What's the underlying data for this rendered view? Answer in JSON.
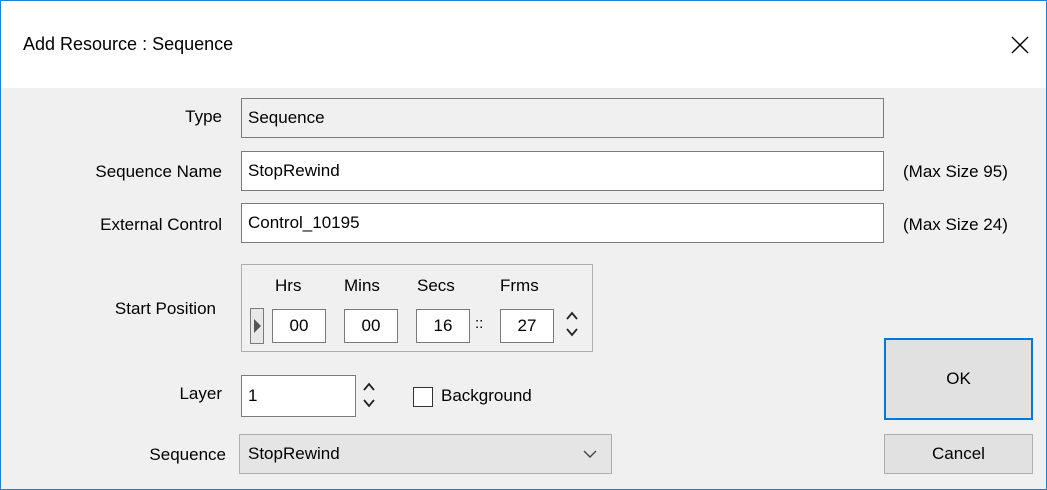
{
  "window": {
    "title": "Add Resource : Sequence",
    "close_label": "close"
  },
  "form": {
    "type_label": "Type",
    "type_value": "Sequence",
    "name_label": "Sequence Name",
    "name_value": "StopRewind",
    "name_hint": "(Max Size 95)",
    "external_label": "External Control",
    "external_value": "Control_10195",
    "external_hint": "(Max Size 24)",
    "start_label": "Start Position",
    "timecode": {
      "hrs_label": "Hrs",
      "mins_label": "Mins",
      "secs_label": "Secs",
      "frms_label": "Frms",
      "hrs": "00",
      "mins": "00",
      "secs": "16",
      "frms": "27",
      "separator": "::"
    },
    "layer_label": "Layer",
    "layer_value": "1",
    "background_label": "Background",
    "background_checked": false,
    "sequence_label": "Sequence",
    "sequence_value": "StopRewind"
  },
  "buttons": {
    "ok": "OK",
    "cancel": "Cancel"
  },
  "colors": {
    "window_border": "#1883d7",
    "default_button_border": "#0078d7",
    "dialog_bg": "#f0f0f0"
  },
  "icons": [
    "close-icon",
    "spin-up-icon",
    "spin-down-icon",
    "play-marker-icon",
    "chevron-down-icon"
  ]
}
